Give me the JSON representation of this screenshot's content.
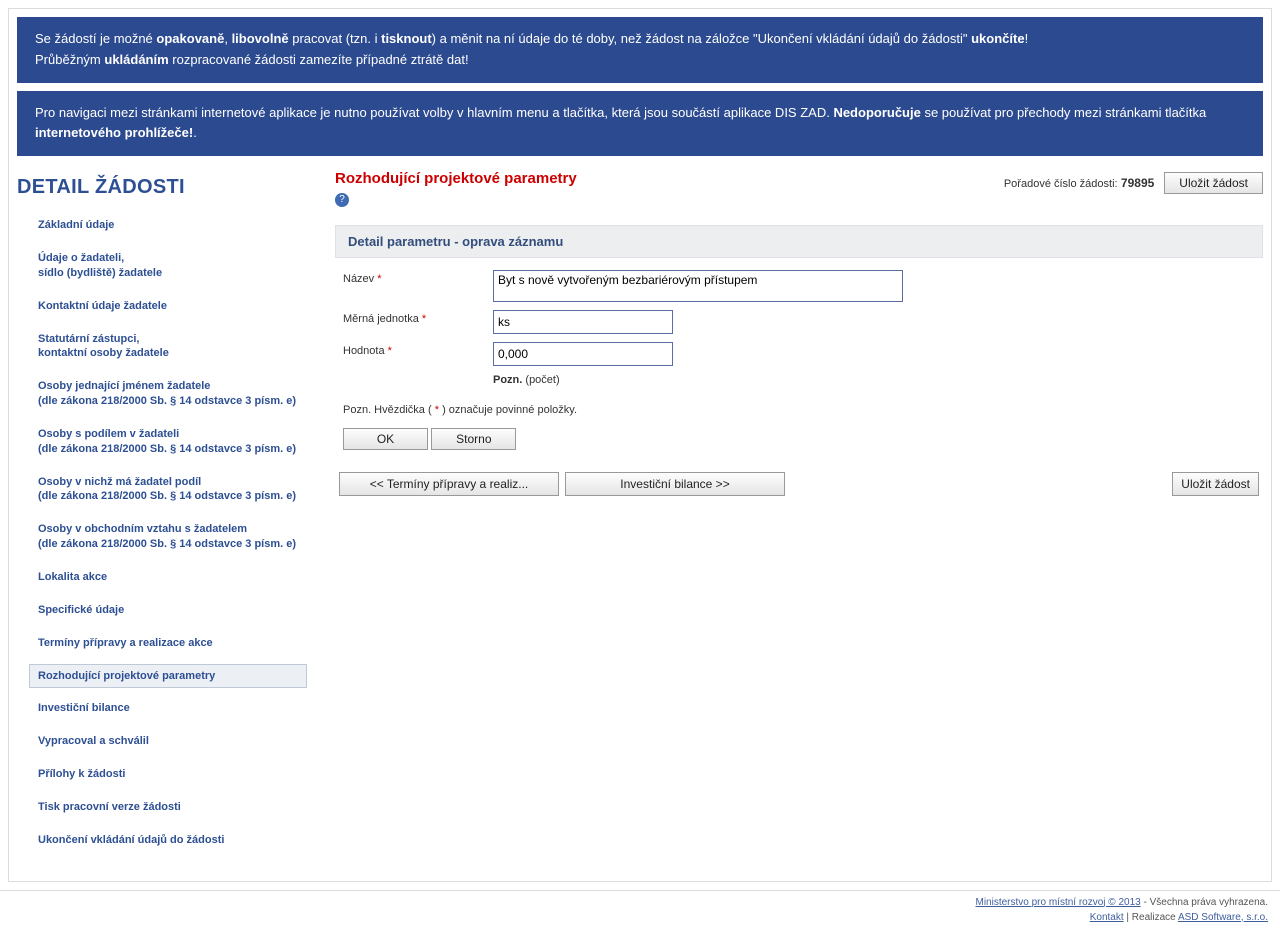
{
  "notices": {
    "n1_html": "Se žádostí je možné <strong>opakovaně</strong>, <strong>libovolně</strong> pracovat (tzn. i <strong>tisknout</strong>) a měnit na ní údaje do té doby, než žádost na záložce \"Ukončení vkládání údajů do žádosti\" <strong>ukončíte</strong>!<br>Průběžným <strong>ukládáním</strong> rozpracované žádosti zamezíte případné ztrátě dat!",
    "n2_html": "Pro navigaci mezi stránkami internetové aplikace je nutno používat volby v hlavním menu a tlačítka, která jsou součástí aplikace DIS ZAD. <strong>Nedoporučuje</strong> se používat pro přechody mezi stránkami tlačítka <strong>internetového prohlížeče!</strong>."
  },
  "sidebar": {
    "title": "DETAIL ŽÁDOSTI",
    "items": [
      {
        "label": "Základní údaje"
      },
      {
        "label": "Údaje o žadateli,",
        "sub": "sídlo (bydliště) žadatele"
      },
      {
        "label": "Kontaktní údaje žadatele"
      },
      {
        "label": "Statutární zástupci,",
        "sub": "kontaktní osoby žadatele"
      },
      {
        "label": "Osoby jednající jménem žadatele",
        "sub": "(dle zákona 218/2000 Sb. § 14 odstavce 3 písm. e)"
      },
      {
        "label": "Osoby s podílem v žadateli",
        "sub": "(dle zákona 218/2000 Sb. § 14 odstavce 3 písm. e)"
      },
      {
        "label": "Osoby v nichž má žadatel podíl",
        "sub": "(dle zákona 218/2000 Sb. § 14 odstavce 3 písm. e)"
      },
      {
        "label": "Osoby v obchodním vztahu s žadatelem",
        "sub": "(dle zákona 218/2000 Sb. § 14 odstavce 3 písm. e)"
      },
      {
        "label": "Lokalita akce"
      },
      {
        "label": "Specifické údaje"
      },
      {
        "label": "Termíny přípravy a realizace akce"
      },
      {
        "label": "Rozhodující projektové parametry",
        "active": true
      },
      {
        "label": "Investiční bilance"
      },
      {
        "label": "Vypracoval a schválil"
      },
      {
        "label": "Přílohy k žádosti"
      },
      {
        "label": "Tisk pracovní verze žádosti"
      },
      {
        "label": "Ukončení vkládání údajů do žádosti"
      }
    ]
  },
  "main": {
    "heading": "Rozhodující projektové parametry",
    "order_label": "Pořadové číslo žádosti:",
    "order_value": "79895",
    "save_btn": "Uložit žádost",
    "section_title": "Detail parametru - oprava záznamu",
    "fields": {
      "name_label": "Název",
      "name_value": "Byt s nově vytvořeným bezbariérovým přístupem",
      "unit_label": "Měrná jednotka",
      "unit_value": "ks",
      "value_label": "Hodnota",
      "value_value": "0,000",
      "note_label": "Pozn.",
      "note_value": "(počet)"
    },
    "fine_note_pre": "Pozn. Hvězdička (",
    "fine_note_post": ") označuje povinné položky.",
    "ok": "OK",
    "cancel": "Storno",
    "nav_prev": "<<   Termíny přípravy a realiz...",
    "nav_next": "Investiční bilance  >>"
  },
  "footer": {
    "line1_link": "Ministerstvo pro místní rozvoj © 2013",
    "line1_rest": " - Všechna práva vyhrazena.",
    "kontakt": "Kontakt",
    "sep": " | Realizace ",
    "realizace": "ASD Software, s.r.o."
  }
}
